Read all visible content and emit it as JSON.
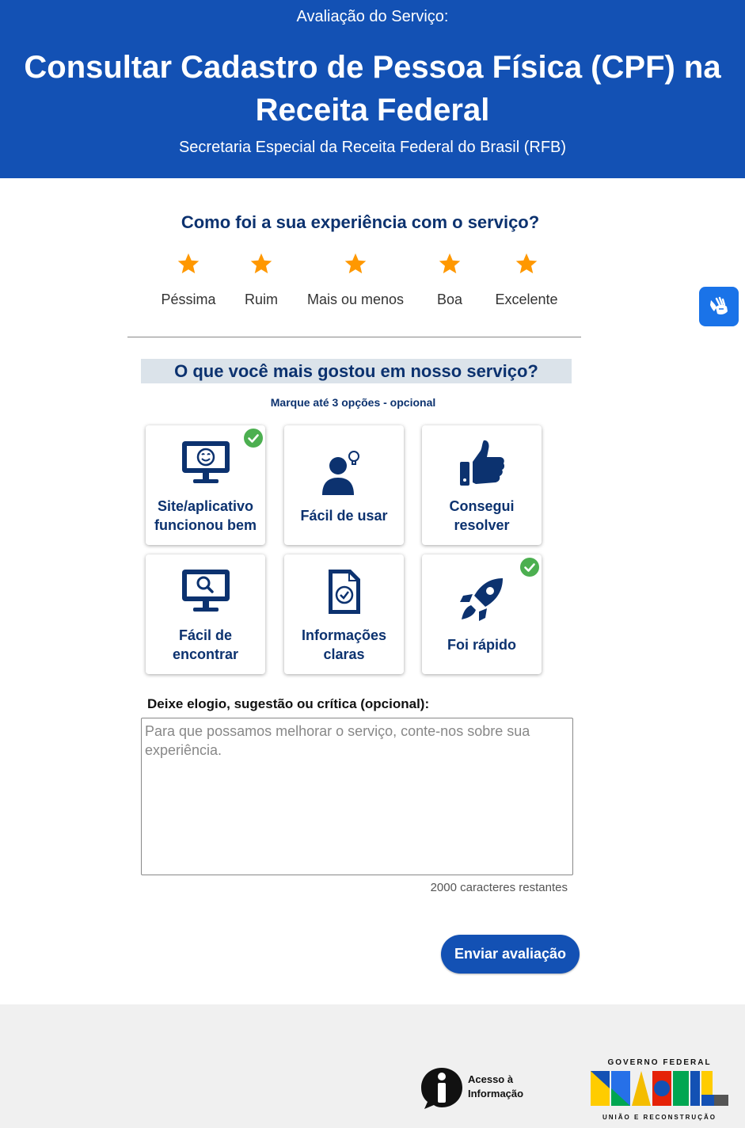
{
  "header": {
    "pre_title": "Avaliação do Serviço:",
    "title": "Consultar Cadastro de Pessoa Física (CPF) na Receita Federal",
    "organization": "Secretaria Especial da Receita Federal do Brasil (RFB)"
  },
  "experience": {
    "question": "Como foi a sua experiência com o serviço?",
    "options": [
      {
        "label": "Péssima",
        "icon": "star-icon"
      },
      {
        "label": "Ruim",
        "icon": "star-icon"
      },
      {
        "label": "Mais ou menos",
        "icon": "star-icon"
      },
      {
        "label": "Boa",
        "icon": "star-icon"
      },
      {
        "label": "Excelente",
        "icon": "star-icon"
      }
    ]
  },
  "liked": {
    "question": "O que você mais gostou em nosso serviço?",
    "hint": "Marque até 3 opções - opcional",
    "options": [
      {
        "label": "Site/aplicativo funcionou bem",
        "icon": "smiling-monitor-icon",
        "selected": true
      },
      {
        "label": "Fácil de usar",
        "icon": "user-idea-icon",
        "selected": false
      },
      {
        "label": "Consegui resolver",
        "icon": "thumbs-up-icon",
        "selected": false
      },
      {
        "label": "Fácil de encontrar",
        "icon": "search-monitor-icon",
        "selected": false
      },
      {
        "label": "Informações claras",
        "icon": "checked-document-icon",
        "selected": false
      },
      {
        "label": "Foi rápido",
        "icon": "rocket-icon",
        "selected": true
      }
    ]
  },
  "comment": {
    "label": "Deixe elogio, sugestão ou crítica (opcional):",
    "placeholder": "Para que possamos melhorar o serviço, conte-nos sobre sua experiência.",
    "value": "",
    "counter": "2000 caracteres restantes"
  },
  "submit": {
    "label": "Enviar avaliação"
  },
  "footer": {
    "access_info": "Acesso à Informação",
    "gov_top": "GOVERNO FEDERAL",
    "gov_word": "BRASIL",
    "gov_bottom": "UNIÃO E RECONSTRUÇÃO"
  },
  "colors": {
    "primary": "#1351b4",
    "navy": "#0c326f",
    "star": "#ff9800",
    "check": "#4caf50",
    "vlibras": "#1a73e8"
  }
}
